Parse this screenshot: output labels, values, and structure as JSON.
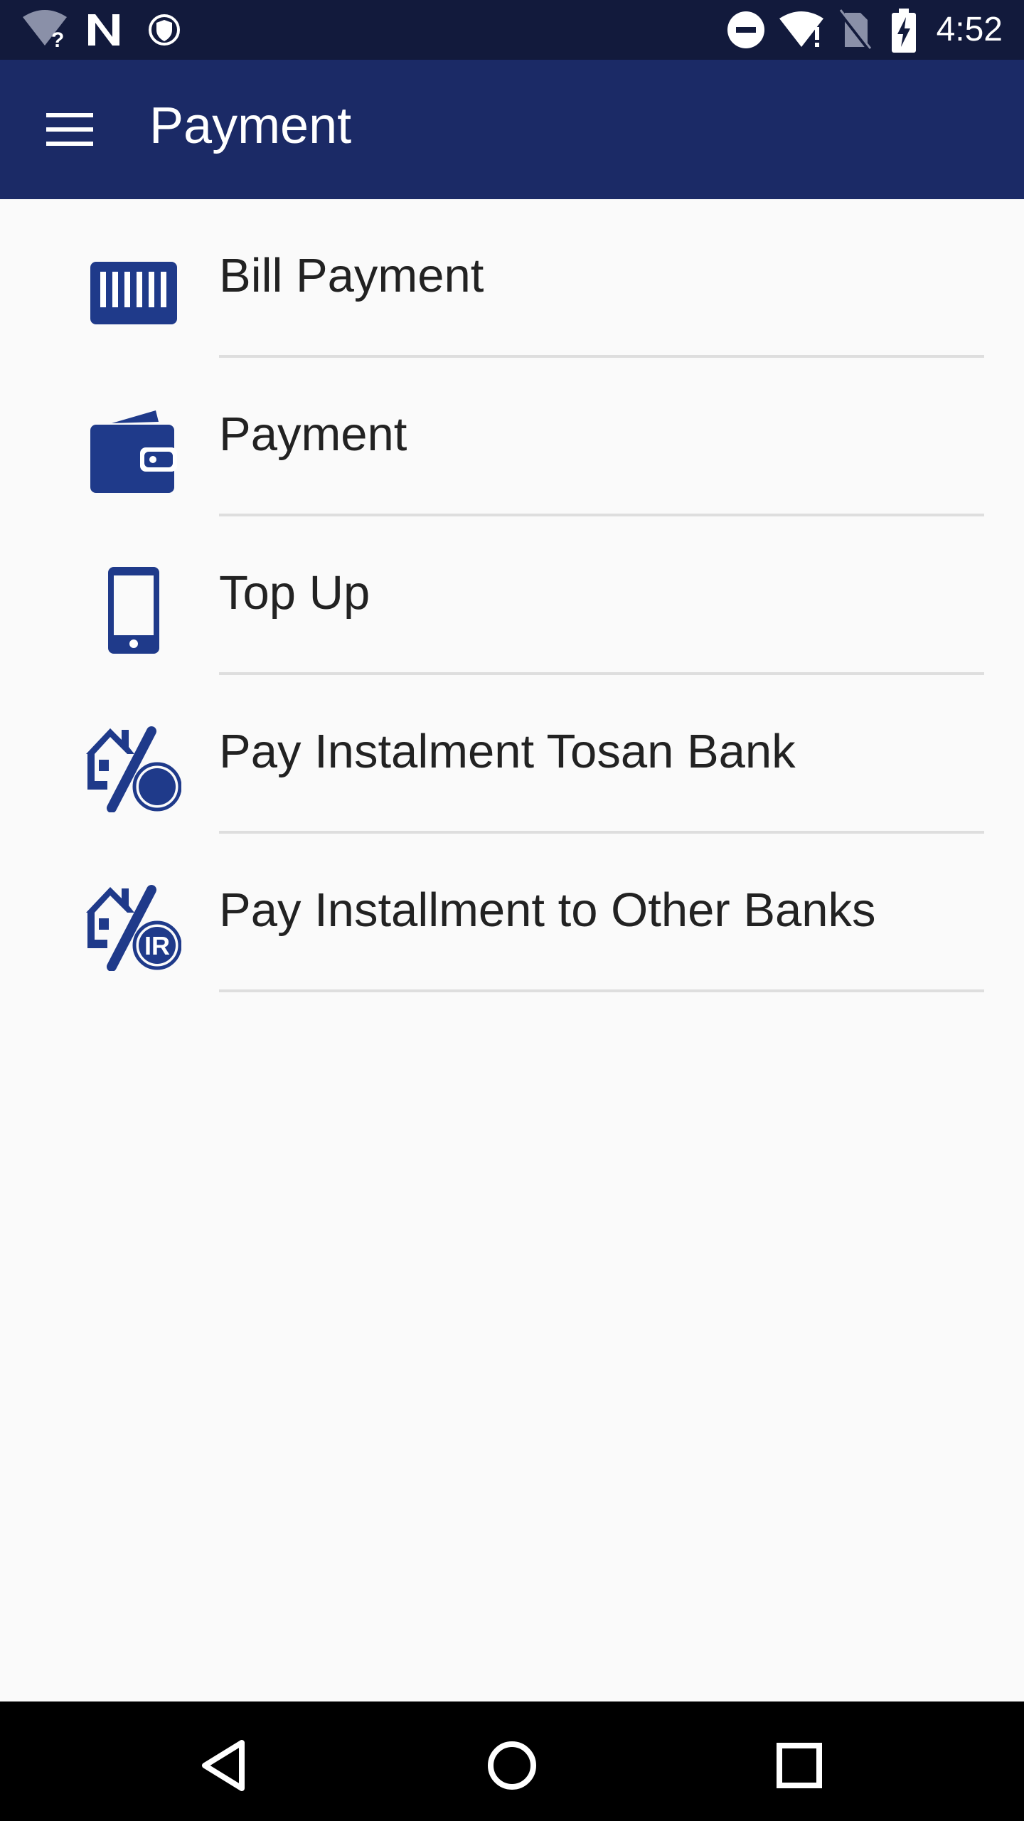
{
  "status_bar": {
    "time": "4:52",
    "left_icons": [
      "wifi-unknown-icon",
      "n-notification-icon",
      "vpn-shield-icon"
    ],
    "right_icons": [
      "do-not-disturb-icon",
      "wifi-alert-icon",
      "no-sim-icon",
      "battery-charging-icon"
    ]
  },
  "app_bar": {
    "title": "Payment",
    "menu_icon": "hamburger-menu-icon"
  },
  "menu": {
    "items": [
      {
        "label": "Bill Payment",
        "icon": "barcode-icon"
      },
      {
        "label": "Payment",
        "icon": "wallet-icon"
      },
      {
        "label": "Top Up",
        "icon": "phone-icon"
      },
      {
        "label": "Pay Instalment Tosan Bank",
        "icon": "house-percent-coin-icon"
      },
      {
        "label": "Pay Installment to Other Banks",
        "icon": "house-percent-ir-icon"
      }
    ]
  },
  "colors": {
    "status_bar": "#121a3c",
    "app_bar": "#1b2a66",
    "icon": "#1f3a8a",
    "background": "#fafafa",
    "nav_bar": "#000000"
  },
  "nav_bar": {
    "buttons": [
      "back-icon",
      "home-icon",
      "recents-icon"
    ]
  }
}
